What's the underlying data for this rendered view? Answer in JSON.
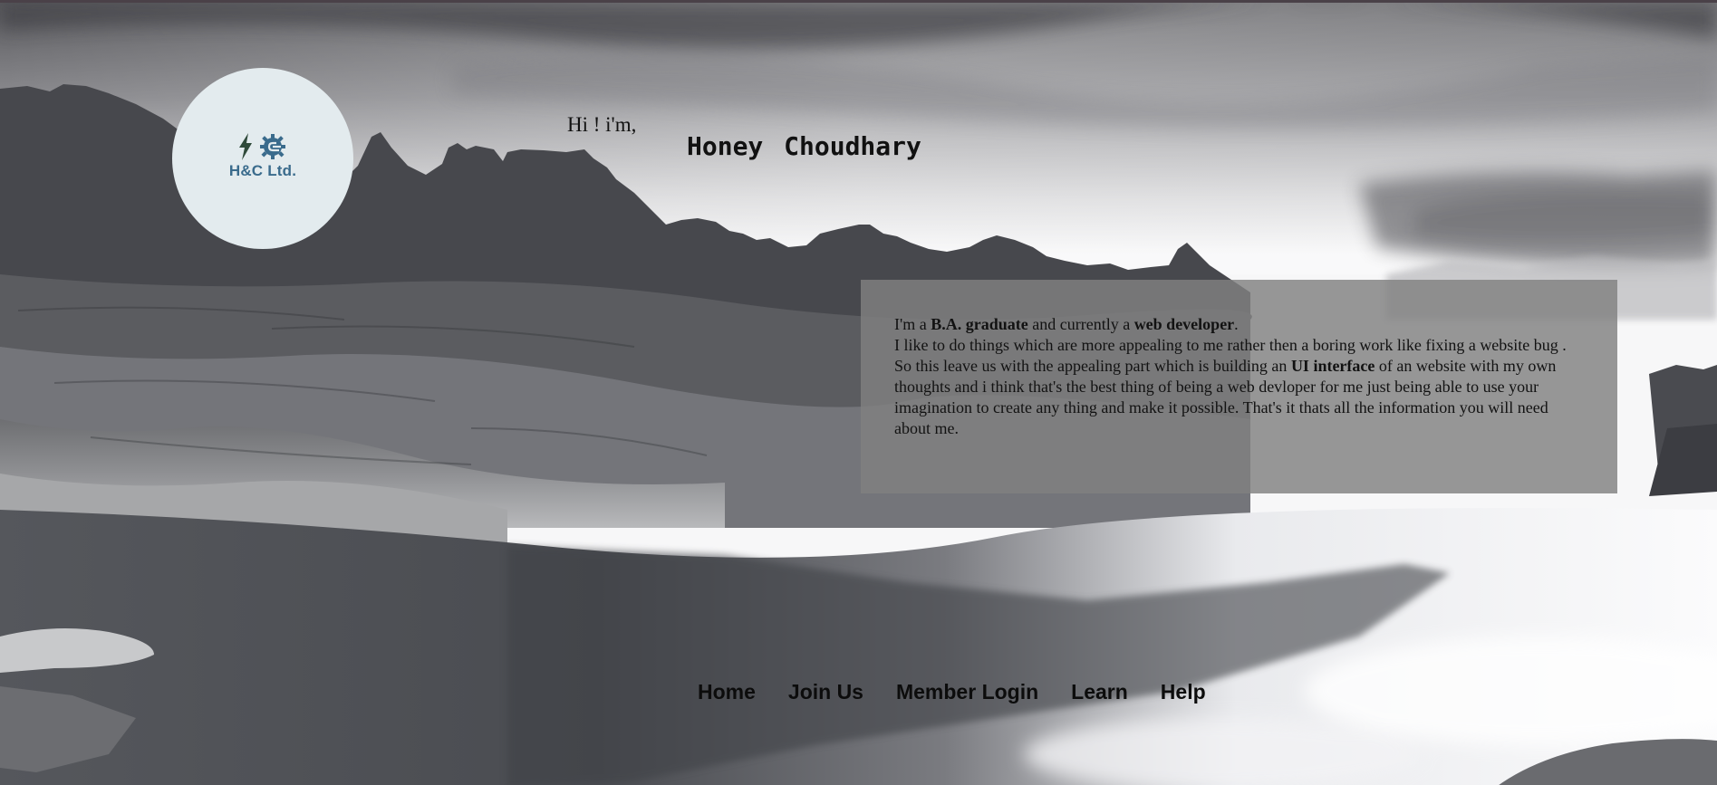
{
  "header": {
    "logo_text": "H&C Ltd.",
    "logo_icons": [
      "lightning-icon",
      "gear-icon"
    ],
    "greeting": "Hi ! i'm,",
    "name": "Honey  Choudhary"
  },
  "about": {
    "line1_pre": "I'm a ",
    "line1_b1": "B.A. graduate",
    "line1_mid": " and currently a ",
    "line1_b2": "web developer",
    "line1_end": ".",
    "line2": "I like to do things which are more appealing to me rather then a boring work like fixing a website bug .",
    "line3_pre": "So this leave us with the appealing part which is building an ",
    "line3_b": "UI interface",
    "line3_post": " of an website with my own thoughts and i think that's the best thing of being a web devloper for me just being able to use your imagination to create any thing and make it possible. That's it thats all the information you will need about me."
  },
  "nav": {
    "items": [
      {
        "label": "Home"
      },
      {
        "label": "Join Us"
      },
      {
        "label": "Member Login"
      },
      {
        "label": "Learn"
      },
      {
        "label": "Help"
      }
    ]
  },
  "colors": {
    "logo_circle": "#e3ebee",
    "logo_text": "#3a6b8c",
    "card_bg": "#808080",
    "text": "#111111"
  }
}
